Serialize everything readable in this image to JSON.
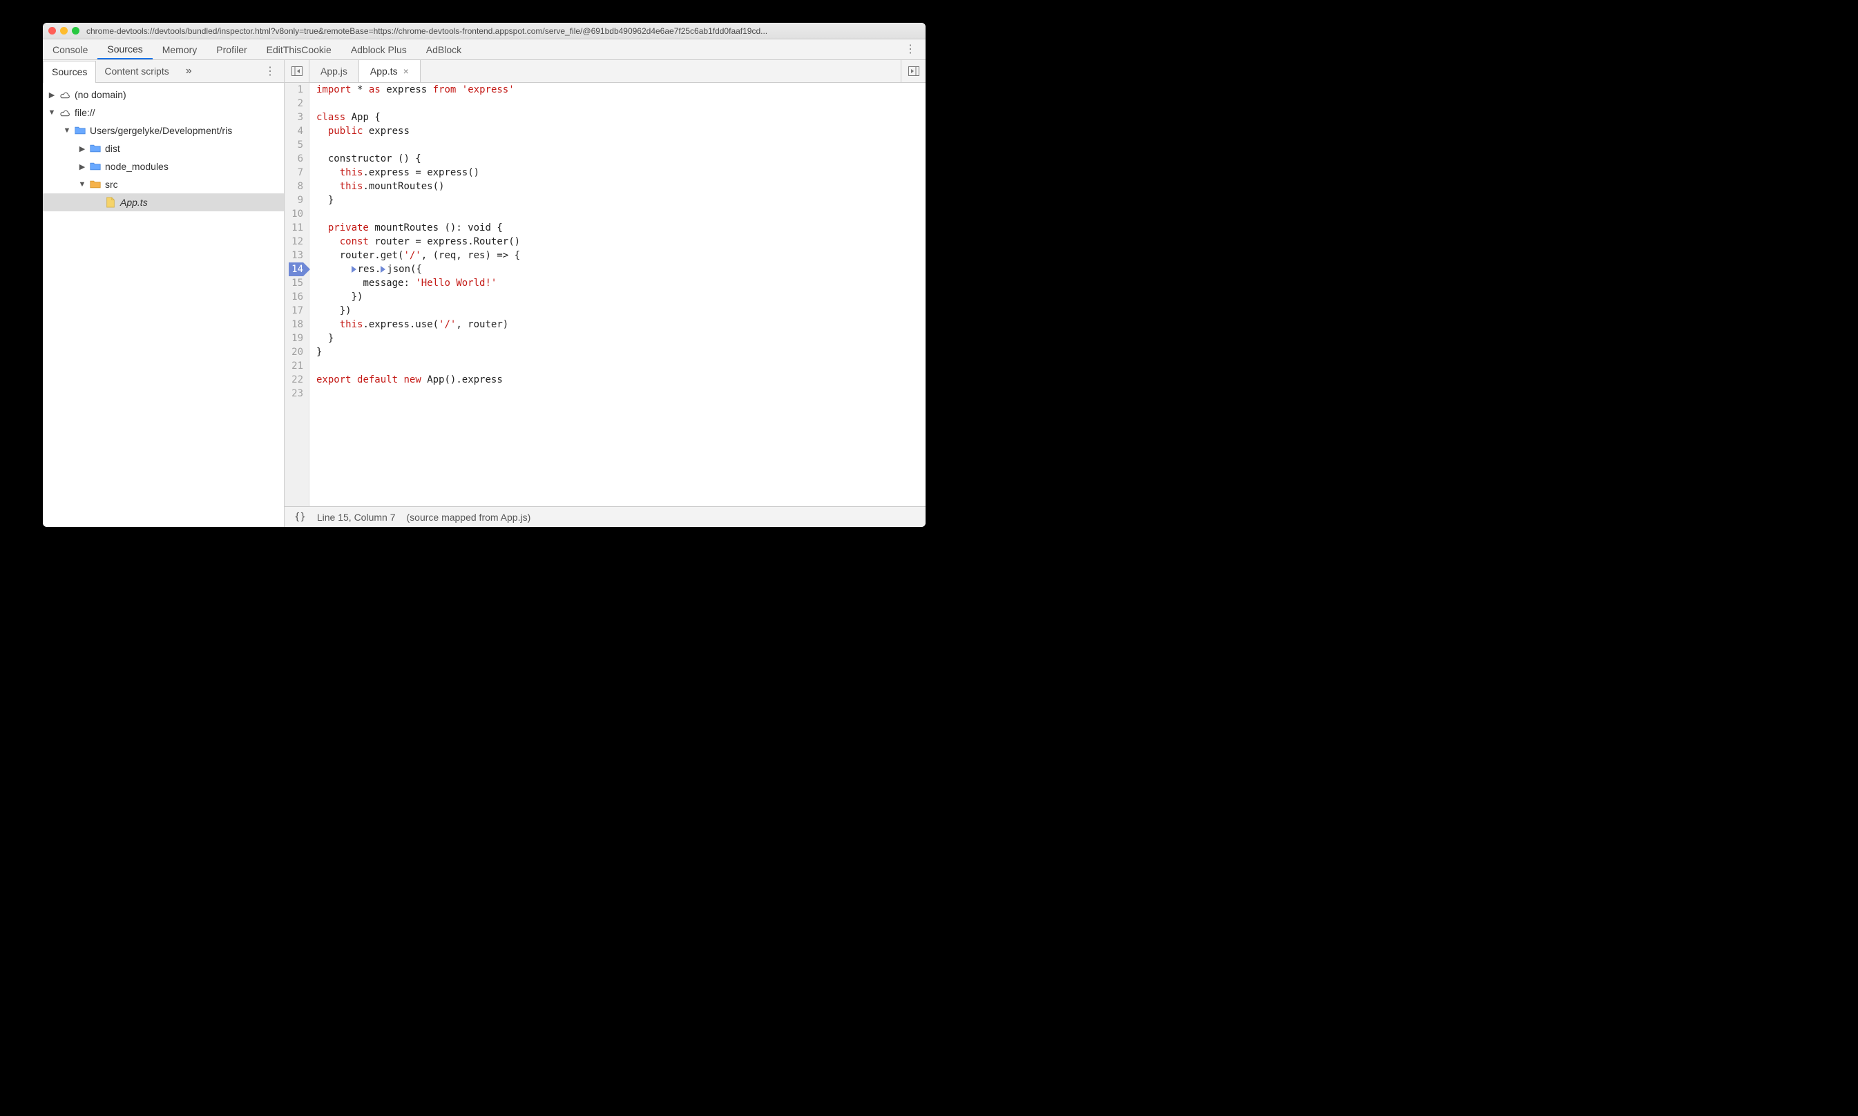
{
  "titlebar": {
    "url": "chrome-devtools://devtools/bundled/inspector.html?v8only=true&remoteBase=https://chrome-devtools-frontend.appspot.com/serve_file/@691bdb490962d4e6ae7f25c6ab1fdd0faaf19cd..."
  },
  "panel_tabs": [
    "Console",
    "Sources",
    "Memory",
    "Profiler",
    "EditThisCookie",
    "Adblock Plus",
    "AdBlock"
  ],
  "panel_tabs_active_index": 1,
  "sidebar_tabs": [
    "Sources",
    "Content scripts"
  ],
  "sidebar_tabs_active_index": 0,
  "sidebar_more": "»",
  "tree": [
    {
      "indent": 0,
      "expanded": false,
      "icon": "cloud",
      "label": "(no domain)",
      "italic": false,
      "selected": false
    },
    {
      "indent": 0,
      "expanded": true,
      "icon": "cloud",
      "label": "file://",
      "italic": false,
      "selected": false
    },
    {
      "indent": 1,
      "expanded": true,
      "icon": "folder-blue",
      "label": "Users/gergelyke/Development/ris",
      "italic": false,
      "selected": false
    },
    {
      "indent": 2,
      "expanded": false,
      "icon": "folder-blue",
      "label": "dist",
      "italic": false,
      "selected": false
    },
    {
      "indent": 2,
      "expanded": false,
      "icon": "folder-blue",
      "label": "node_modules",
      "italic": false,
      "selected": false
    },
    {
      "indent": 2,
      "expanded": true,
      "icon": "folder-orange",
      "label": "src",
      "italic": false,
      "selected": false
    },
    {
      "indent": 3,
      "expanded": null,
      "icon": "file",
      "label": "App.ts",
      "italic": true,
      "selected": true
    }
  ],
  "editor_tabs": [
    {
      "label": "App.js",
      "active": false,
      "closable": false
    },
    {
      "label": "App.ts",
      "active": true,
      "closable": true
    }
  ],
  "breakpoint_line": 14,
  "code_lines": [
    {
      "n": 1,
      "tokens": [
        [
          "kw",
          "import"
        ],
        [
          "sp",
          " "
        ],
        [
          "op",
          "*"
        ],
        [
          "sp",
          " "
        ],
        [
          "kw",
          "as"
        ],
        [
          "sp",
          " "
        ],
        [
          "id",
          "express"
        ],
        [
          "sp",
          " "
        ],
        [
          "kw",
          "from"
        ],
        [
          "sp",
          " "
        ],
        [
          "str",
          "'express'"
        ]
      ]
    },
    {
      "n": 2,
      "tokens": []
    },
    {
      "n": 3,
      "tokens": [
        [
          "kw",
          "class"
        ],
        [
          "sp",
          " "
        ],
        [
          "id",
          "App"
        ],
        [
          "sp",
          " "
        ],
        [
          "op",
          "{"
        ]
      ]
    },
    {
      "n": 4,
      "tokens": [
        [
          "sp",
          "  "
        ],
        [
          "kw",
          "public"
        ],
        [
          "sp",
          " "
        ],
        [
          "id",
          "express"
        ]
      ]
    },
    {
      "n": 5,
      "tokens": []
    },
    {
      "n": 6,
      "tokens": [
        [
          "sp",
          "  "
        ],
        [
          "id",
          "constructor"
        ],
        [
          "sp",
          " "
        ],
        [
          "op",
          "() {"
        ]
      ]
    },
    {
      "n": 7,
      "tokens": [
        [
          "sp",
          "    "
        ],
        [
          "kw",
          "this"
        ],
        [
          "op",
          "."
        ],
        [
          "id",
          "express"
        ],
        [
          "sp",
          " "
        ],
        [
          "op",
          "="
        ],
        [
          "sp",
          " "
        ],
        [
          "id",
          "express()"
        ]
      ]
    },
    {
      "n": 8,
      "tokens": [
        [
          "sp",
          "    "
        ],
        [
          "kw",
          "this"
        ],
        [
          "op",
          "."
        ],
        [
          "id",
          "mountRoutes()"
        ]
      ]
    },
    {
      "n": 9,
      "tokens": [
        [
          "sp",
          "  "
        ],
        [
          "op",
          "}"
        ]
      ]
    },
    {
      "n": 10,
      "tokens": []
    },
    {
      "n": 11,
      "tokens": [
        [
          "sp",
          "  "
        ],
        [
          "kw",
          "private"
        ],
        [
          "sp",
          " "
        ],
        [
          "id",
          "mountRoutes"
        ],
        [
          "sp",
          " "
        ],
        [
          "op",
          "():"
        ],
        [
          "sp",
          " "
        ],
        [
          "id",
          "void"
        ],
        [
          "sp",
          " "
        ],
        [
          "op",
          "{"
        ]
      ]
    },
    {
      "n": 12,
      "tokens": [
        [
          "sp",
          "    "
        ],
        [
          "kw",
          "const"
        ],
        [
          "sp",
          " "
        ],
        [
          "id",
          "router"
        ],
        [
          "sp",
          " "
        ],
        [
          "op",
          "="
        ],
        [
          "sp",
          " "
        ],
        [
          "id",
          "express.Router()"
        ]
      ]
    },
    {
      "n": 13,
      "tokens": [
        [
          "sp",
          "    "
        ],
        [
          "id",
          "router.get("
        ],
        [
          "str",
          "'/'"
        ],
        [
          "op",
          ", (req, res) => {"
        ]
      ]
    },
    {
      "n": 14,
      "tokens": [
        [
          "sp",
          "      "
        ],
        [
          "marker",
          ""
        ],
        [
          "id",
          "res."
        ],
        [
          "marker",
          ""
        ],
        [
          "id",
          "json({"
        ]
      ]
    },
    {
      "n": 15,
      "tokens": [
        [
          "sp",
          "        "
        ],
        [
          "id",
          "message:"
        ],
        [
          "sp",
          " "
        ],
        [
          "str",
          "'Hello World!'"
        ]
      ]
    },
    {
      "n": 16,
      "tokens": [
        [
          "sp",
          "      "
        ],
        [
          "op",
          "})"
        ]
      ]
    },
    {
      "n": 17,
      "tokens": [
        [
          "sp",
          "    "
        ],
        [
          "op",
          "})"
        ]
      ]
    },
    {
      "n": 18,
      "tokens": [
        [
          "sp",
          "    "
        ],
        [
          "kw",
          "this"
        ],
        [
          "op",
          "."
        ],
        [
          "id",
          "express.use("
        ],
        [
          "str",
          "'/'"
        ],
        [
          "op",
          ", router)"
        ]
      ]
    },
    {
      "n": 19,
      "tokens": [
        [
          "sp",
          "  "
        ],
        [
          "op",
          "}"
        ]
      ]
    },
    {
      "n": 20,
      "tokens": [
        [
          "op",
          "}"
        ]
      ]
    },
    {
      "n": 21,
      "tokens": []
    },
    {
      "n": 22,
      "tokens": [
        [
          "kw",
          "export"
        ],
        [
          "sp",
          " "
        ],
        [
          "kw",
          "default"
        ],
        [
          "sp",
          " "
        ],
        [
          "kw",
          "new"
        ],
        [
          "sp",
          " "
        ],
        [
          "id",
          "App().express"
        ]
      ]
    },
    {
      "n": 23,
      "tokens": []
    }
  ],
  "statusbar": {
    "pretty": "{}",
    "position": "Line 15, Column 7",
    "mapping": "(source mapped from App.js)"
  }
}
